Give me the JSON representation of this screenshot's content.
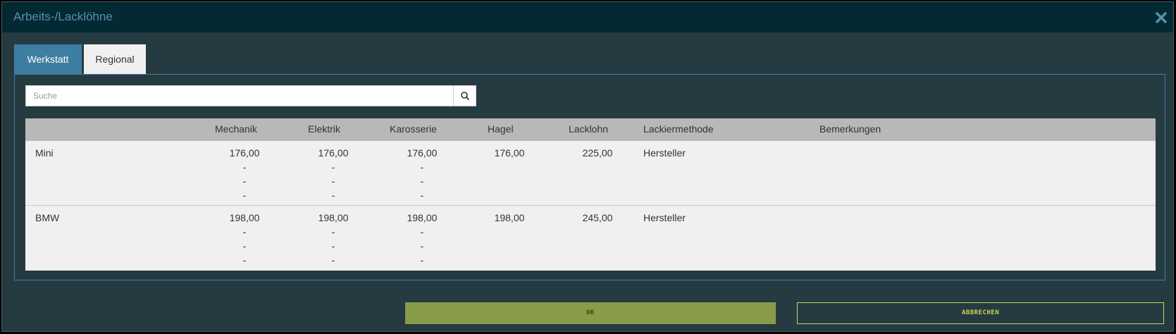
{
  "dialog": {
    "title": "Arbeits-/Lacklöhne",
    "close_icon": "close-icon"
  },
  "tabs": [
    {
      "label": "Werkstatt",
      "active": true
    },
    {
      "label": "Regional",
      "active": false
    }
  ],
  "search": {
    "placeholder": "Suche",
    "value": "",
    "icon": "search-icon"
  },
  "table": {
    "columns": [
      "Mechanik",
      "Elektrik",
      "Karosserie",
      "Hagel",
      "Lacklohn",
      "Lackiermethode",
      "Bemerkungen"
    ],
    "rows": [
      {
        "name": "Mini",
        "mechanik": [
          "176,00",
          "-",
          "-",
          "-"
        ],
        "elektrik": [
          "176,00",
          "-",
          "-",
          "-"
        ],
        "karosserie": [
          "176,00",
          "-",
          "-",
          "-"
        ],
        "hagel": "176,00",
        "lacklohn": "225,00",
        "lackiermethode": "Hersteller",
        "bemerkungen": ""
      },
      {
        "name": "BMW",
        "mechanik": [
          "198,00",
          "-",
          "-",
          "-"
        ],
        "elektrik": [
          "198,00",
          "-",
          "-",
          "-"
        ],
        "karosserie": [
          "198,00",
          "-",
          "-",
          "-"
        ],
        "hagel": "198,00",
        "lacklohn": "245,00",
        "lackiermethode": "Hersteller",
        "bemerkungen": ""
      }
    ]
  },
  "buttons": {
    "ok_label": "OK",
    "cancel_label": "ABBRECHEN"
  },
  "colors": {
    "titlebar": "#032a33",
    "body": "#263a41",
    "tab_active": "#3e7ea1",
    "ok": "#889b48",
    "cancel_border": "#c6d65b"
  }
}
